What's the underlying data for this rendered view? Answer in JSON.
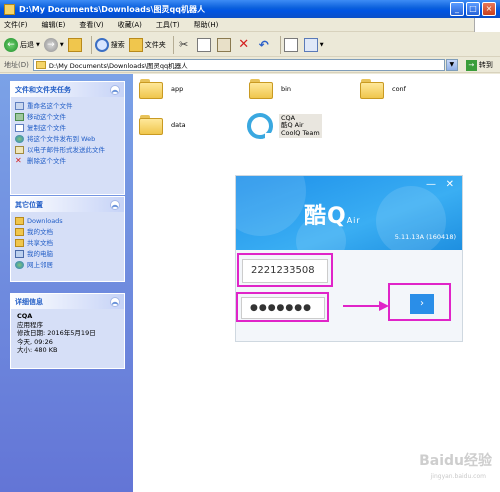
{
  "window": {
    "title": "D:\\My Documents\\Downloads\\图灵qq机器人"
  },
  "menu": [
    "文件(F)",
    "编辑(E)",
    "查看(V)",
    "收藏(A)",
    "工具(T)",
    "帮助(H)"
  ],
  "toolbar": {
    "back": "后退",
    "search": "搜索",
    "folders": "文件夹"
  },
  "address": {
    "label": "地址(D)",
    "path": "D:\\My Documents\\Downloads\\图灵qq机器人",
    "go": "转到"
  },
  "sidebar": {
    "tasks": {
      "title": "文件和文件夹任务",
      "items": [
        "重命名这个文件",
        "移动这个文件",
        "复制这个文件",
        "将这个文件发布到 Web",
        "以电子邮件形式发送此文件",
        "删除这个文件"
      ]
    },
    "places": {
      "title": "其它位置",
      "items": [
        "Downloads",
        "我的文档",
        "共享文档",
        "我的电脑",
        "网上邻居"
      ]
    },
    "details": {
      "title": "详细信息",
      "name": "CQA",
      "type": "应用程序",
      "modified": "修改日期: 2016年5月19日",
      "modified2": "今天, 09:26",
      "size": "大小: 480 KB"
    }
  },
  "files": {
    "app": "app",
    "bin": "bin",
    "conf": "conf",
    "data": "data",
    "cqa_line1": "CQA",
    "cqa_line2": "酷Q Air",
    "cqa_line3": "CoolQ Team"
  },
  "qq_login": {
    "logo": "酷Q",
    "logo_sub": "Air",
    "version": "5.11.13A (160418)",
    "username": "2221233508",
    "password_mask": "●●●●●●●",
    "go": "›"
  },
  "watermark": {
    "main": "Baidu经验",
    "sub": "jingyan.baidu.com"
  }
}
